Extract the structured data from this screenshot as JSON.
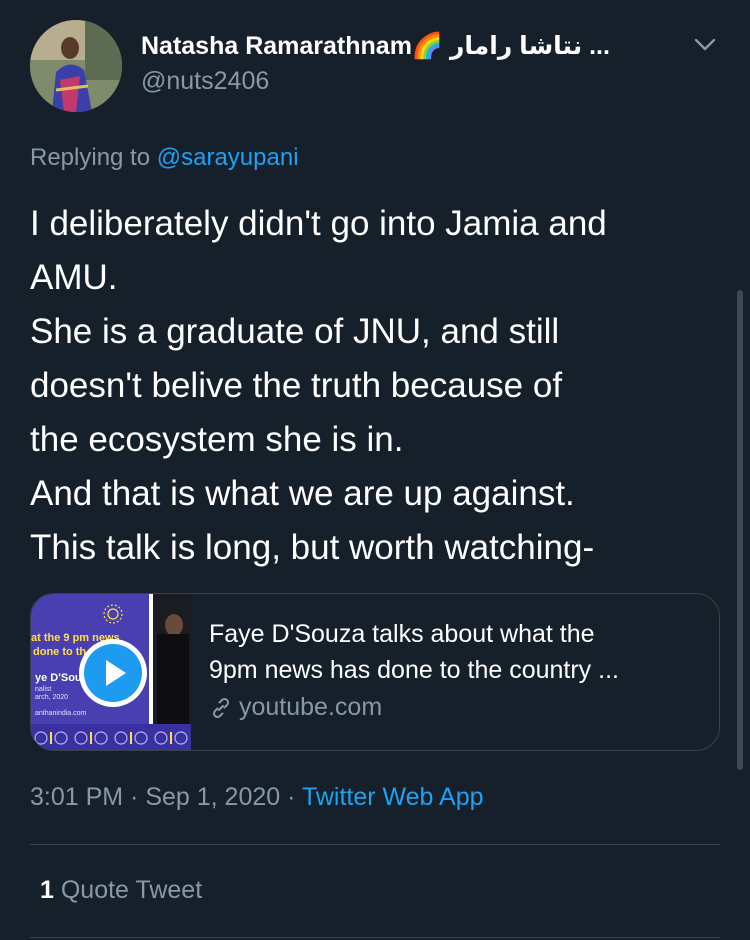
{
  "author": {
    "display_name": "Natasha Ramarathnam🌈 نتاشا رامار ...",
    "handle": "@nuts2406"
  },
  "reply": {
    "prefix": "Replying to",
    "mention": "@sarayupani"
  },
  "tweet": {
    "lines": [
      "I deliberately didn't go into Jamia and",
      "AMU.",
      "She is a graduate of JNU, and still",
      "doesn't belive the truth because of",
      "the ecosystem she is in.",
      "And that is what we are up against.",
      "This talk is long, but worth watching-"
    ]
  },
  "card": {
    "title_lines": [
      "Faye D'Souza talks about what the",
      "9pm news has done to the country ..."
    ],
    "domain": "youtube.com",
    "thumb_texts": {
      "line1": "at the 9 pm news",
      "line2": "done to th",
      "name": "ye D'Souz",
      "sub1": "nalist",
      "sub2": "arch, 2020",
      "url": "anthanindia.com"
    }
  },
  "meta": {
    "time": "3:01 PM",
    "sep1": " · ",
    "date": "Sep 1, 2020",
    "sep2": " · ",
    "app": "Twitter Web App"
  },
  "stats": {
    "quote_count": "1",
    "quote_label": " Quote Tweet"
  },
  "colors": {
    "background": "#15202b",
    "text_primary": "#ffffff",
    "text_secondary": "#8899a6",
    "accent": "#1da1f2",
    "border": "#38444d"
  },
  "icons": {
    "chevron": "chevron-down-icon",
    "link": "link-icon",
    "play": "play-icon"
  }
}
